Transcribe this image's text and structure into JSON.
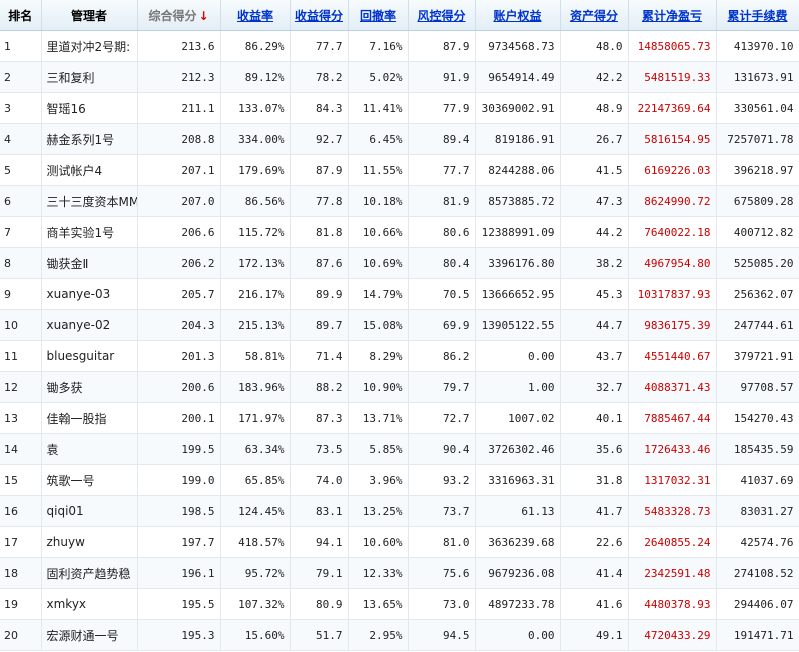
{
  "headers": {
    "rank": "排名",
    "manager": "管理者",
    "composite": "综合得分",
    "composite_arrow": "↓",
    "return_rate": "收益率",
    "return_score": "收益得分",
    "drawdown": "回撤率",
    "risk_score": "风控得分",
    "equity": "账户权益",
    "asset_score": "资产得分",
    "cum_pnl": "累计净盈亏",
    "cum_fee": "累计手续费"
  },
  "colors": {
    "header_link": "#0033cc",
    "profit_red": "#cc0000",
    "sort_arrow": "#e00000"
  },
  "rows": [
    {
      "rank": "1",
      "name": "里道对冲2号期:",
      "composite": "213.6",
      "return_rate": "86.29%",
      "return_score": "77.7",
      "drawdown": "7.16%",
      "risk_score": "87.9",
      "equity": "9734568.73",
      "asset_score": "48.0",
      "cum_pnl": "14858065.73",
      "cum_fee": "413970.10"
    },
    {
      "rank": "2",
      "name": "三和复利",
      "composite": "212.3",
      "return_rate": "89.12%",
      "return_score": "78.2",
      "drawdown": "5.02%",
      "risk_score": "91.9",
      "equity": "9654914.49",
      "asset_score": "42.2",
      "cum_pnl": "5481519.33",
      "cum_fee": "131673.91"
    },
    {
      "rank": "3",
      "name": "智瑶16",
      "composite": "211.1",
      "return_rate": "133.07%",
      "return_score": "84.3",
      "drawdown": "11.41%",
      "risk_score": "77.9",
      "equity": "30369002.91",
      "asset_score": "48.9",
      "cum_pnl": "22147369.64",
      "cum_fee": "330561.04"
    },
    {
      "rank": "4",
      "name": "赫金系列1号",
      "composite": "208.8",
      "return_rate": "334.00%",
      "return_score": "92.7",
      "drawdown": "6.45%",
      "risk_score": "89.4",
      "equity": "819186.91",
      "asset_score": "26.7",
      "cum_pnl": "5816154.95",
      "cum_fee": "7257071.78"
    },
    {
      "rank": "5",
      "name": "测试帐户4",
      "composite": "207.1",
      "return_rate": "179.69%",
      "return_score": "87.9",
      "drawdown": "11.55%",
      "risk_score": "77.7",
      "equity": "8244288.06",
      "asset_score": "41.5",
      "cum_pnl": "6169226.03",
      "cum_fee": "396218.97"
    },
    {
      "rank": "6",
      "name": "三十三度资本MM",
      "composite": "207.0",
      "return_rate": "86.56%",
      "return_score": "77.8",
      "drawdown": "10.18%",
      "risk_score": "81.9",
      "equity": "8573885.72",
      "asset_score": "47.3",
      "cum_pnl": "8624990.72",
      "cum_fee": "675809.28"
    },
    {
      "rank": "7",
      "name": "商羊实验1号",
      "composite": "206.6",
      "return_rate": "115.72%",
      "return_score": "81.8",
      "drawdown": "10.66%",
      "risk_score": "80.6",
      "equity": "12388991.09",
      "asset_score": "44.2",
      "cum_pnl": "7640022.18",
      "cum_fee": "400712.82"
    },
    {
      "rank": "8",
      "name": "锄获金Ⅱ",
      "composite": "206.2",
      "return_rate": "172.13%",
      "return_score": "87.6",
      "drawdown": "10.69%",
      "risk_score": "80.4",
      "equity": "3396176.80",
      "asset_score": "38.2",
      "cum_pnl": "4967954.80",
      "cum_fee": "525085.20"
    },
    {
      "rank": "9",
      "name": "xuanye-03",
      "composite": "205.7",
      "return_rate": "216.17%",
      "return_score": "89.9",
      "drawdown": "14.79%",
      "risk_score": "70.5",
      "equity": "13666652.95",
      "asset_score": "45.3",
      "cum_pnl": "10317837.93",
      "cum_fee": "256362.07"
    },
    {
      "rank": "10",
      "name": "xuanye-02",
      "composite": "204.3",
      "return_rate": "215.13%",
      "return_score": "89.7",
      "drawdown": "15.08%",
      "risk_score": "69.9",
      "equity": "13905122.55",
      "asset_score": "44.7",
      "cum_pnl": "9836175.39",
      "cum_fee": "247744.61"
    },
    {
      "rank": "11",
      "name": "bluesguitar",
      "composite": "201.3",
      "return_rate": "58.81%",
      "return_score": "71.4",
      "drawdown": "8.29%",
      "risk_score": "86.2",
      "equity": "0.00",
      "asset_score": "43.7",
      "cum_pnl": "4551440.67",
      "cum_fee": "379721.91"
    },
    {
      "rank": "12",
      "name": "锄多获",
      "composite": "200.6",
      "return_rate": "183.96%",
      "return_score": "88.2",
      "drawdown": "10.90%",
      "risk_score": "79.7",
      "equity": "1.00",
      "asset_score": "32.7",
      "cum_pnl": "4088371.43",
      "cum_fee": "97708.57"
    },
    {
      "rank": "13",
      "name": "佳翰一股指",
      "composite": "200.1",
      "return_rate": "171.97%",
      "return_score": "87.3",
      "drawdown": "13.71%",
      "risk_score": "72.7",
      "equity": "1007.02",
      "asset_score": "40.1",
      "cum_pnl": "7885467.44",
      "cum_fee": "154270.43"
    },
    {
      "rank": "14",
      "name": "袁",
      "composite": "199.5",
      "return_rate": "63.34%",
      "return_score": "73.5",
      "drawdown": "5.85%",
      "risk_score": "90.4",
      "equity": "3726302.46",
      "asset_score": "35.6",
      "cum_pnl": "1726433.46",
      "cum_fee": "185435.59"
    },
    {
      "rank": "15",
      "name": "筑歌一号",
      "composite": "199.0",
      "return_rate": "65.85%",
      "return_score": "74.0",
      "drawdown": "3.96%",
      "risk_score": "93.2",
      "equity": "3316963.31",
      "asset_score": "31.8",
      "cum_pnl": "1317032.31",
      "cum_fee": "41037.69"
    },
    {
      "rank": "16",
      "name": "qiqi01",
      "composite": "198.5",
      "return_rate": "124.45%",
      "return_score": "83.1",
      "drawdown": "13.25%",
      "risk_score": "73.7",
      "equity": "61.13",
      "asset_score": "41.7",
      "cum_pnl": "5483328.73",
      "cum_fee": "83031.27"
    },
    {
      "rank": "17",
      "name": "zhuyw",
      "composite": "197.7",
      "return_rate": "418.57%",
      "return_score": "94.1",
      "drawdown": "10.60%",
      "risk_score": "81.0",
      "equity": "3636239.68",
      "asset_score": "22.6",
      "cum_pnl": "2640855.24",
      "cum_fee": "42574.76"
    },
    {
      "rank": "18",
      "name": "固利资产趋势稳",
      "composite": "196.1",
      "return_rate": "95.72%",
      "return_score": "79.1",
      "drawdown": "12.33%",
      "risk_score": "75.6",
      "equity": "9679236.08",
      "asset_score": "41.4",
      "cum_pnl": "2342591.48",
      "cum_fee": "274108.52"
    },
    {
      "rank": "19",
      "name": "xmkyx",
      "composite": "195.5",
      "return_rate": "107.32%",
      "return_score": "80.9",
      "drawdown": "13.65%",
      "risk_score": "73.0",
      "equity": "4897233.78",
      "asset_score": "41.6",
      "cum_pnl": "4480378.93",
      "cum_fee": "294406.07"
    },
    {
      "rank": "20",
      "name": "宏源财通一号",
      "composite": "195.3",
      "return_rate": "15.60%",
      "return_score": "51.7",
      "drawdown": "2.95%",
      "risk_score": "94.5",
      "equity": "0.00",
      "asset_score": "49.1",
      "cum_pnl": "4720433.29",
      "cum_fee": "191471.71"
    }
  ]
}
